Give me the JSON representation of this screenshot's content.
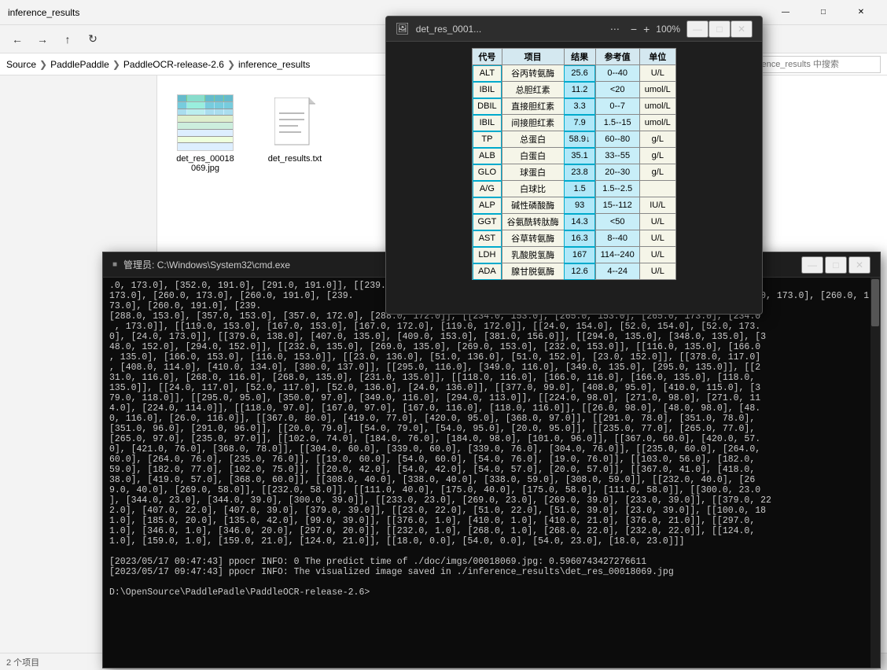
{
  "explorer": {
    "title": "inference_results",
    "breadcrumb": [
      "Source",
      "PaddlePaddle",
      "PaddleOCR-release-2.6",
      "inference_results"
    ],
    "search_placeholder": "在 inference_results 中搜索",
    "files": [
      {
        "name": "det_res_00018069.jpg",
        "type": "jpg"
      },
      {
        "name": "det_results.txt",
        "type": "txt"
      }
    ]
  },
  "viewer": {
    "title": "det_res_0001...",
    "zoom": "100%",
    "table": {
      "headers": [
        "代号",
        "项目",
        "结果",
        "参考值",
        "单位"
      ],
      "rows": [
        [
          "ALT",
          "谷丙转氨酶",
          "25.6",
          "0--40",
          "U/L"
        ],
        [
          "IBIL",
          "总胆红素",
          "11.2",
          "<20",
          "umol/L"
        ],
        [
          "DBIL",
          "直接胆红素",
          "3.3",
          "0--7",
          "umol/L"
        ],
        [
          "IBIL",
          "间接胆红素",
          "7.9",
          "1.5--15",
          "umol/L"
        ],
        [
          "TP",
          "总蛋白",
          "58.9↓",
          "60--80",
          "g/L"
        ],
        [
          "ALB",
          "白蛋白",
          "35.1",
          "33--55",
          "g/L"
        ],
        [
          "GLO",
          "球蛋白",
          "23.8",
          "20--30",
          "g/L"
        ],
        [
          "A/G",
          "白球比",
          "1.5",
          "1.5--2.5",
          ""
        ],
        [
          "ALP",
          "碱性磷酸酶",
          "93",
          "15--112",
          "IU/L"
        ],
        [
          "GGT",
          "谷氨酰转肽酶",
          "14.3",
          "<50",
          "U/L"
        ],
        [
          "AST",
          "谷草转氨酶",
          "16.3",
          "8--40",
          "U/L"
        ],
        [
          "LDH",
          "乳酸脱氢酶",
          "167",
          "114--240",
          "U/L"
        ],
        [
          "ADA",
          "腺甘脱氨酶",
          "12.6",
          "4--24",
          "U/L"
        ]
      ]
    }
  },
  "cmd": {
    "title": "管理员: C:\\Windows\\System32\\cmd.exe",
    "content": ".0, 173.0], [352.0, 191.0], [291.0, 191.0]], [[239.0,\n173.0], [260.0, 173.0], [260.0, 191.0], [239.                                                          , 191.0]], [[239.0, 173.0], [260.0, 173.0], [260.0, 191.0], [239.\n[288.0, 153.0], [357.0, 153.0], [357.0, 172.0], [288.0, 172.0]], [[234.0, 153.0], [265.0, 153.0], [265.0, 173.0], [234.0\n , 173.0]], [[119.0, 153.0], [167.0, 153.0], [167.0, 172.0], [119.0, 172.0]], [[24.0, 154.0], [52.0, 154.0], [52.0, 173.\n0], [24.0, 173.0]], [[379.0, 138.0], [407.0, 135.0], [409.0, 153.0], [381.0, 156.0]], [[294.0, 135.0], [348.0, 135.0], [3\n48.0, 152.0], [294.0, 152.0]], [[232.0, 135.0], [269.0, 135.0], [269.0, 153.0], [232.0, 153.0]], [[116.0, 135.0], [166.0\n, 135.0], [166.0, 153.0], [116.0, 153.0]], [[23.0, 136.0], [51.0, 136.0], [51.0, 152.0], [23.0, 152.0]], [[378.0, 117.0]\n, [408.0, 114.0], [410.0, 134.0], [380.0, 137.0]], [[295.0, 116.0], [349.0, 116.0], [349.0, 135.0], [295.0, 135.0]], [[2\n31.0, 116.0], [268.0, 116.0], [268.0, 135.0], [231.0, 135.0]], [[118.0, 116.0], [166.0, 116.0], [166.0, 135.0], [118.0,\n135.0]], [[24.0, 117.0], [52.0, 117.0], [52.0, 136.0], [24.0, 136.0]], [[377.0, 99.0], [408.0, 95.0], [410.0, 115.0], [3\n79.0, 118.0]], [[295.0, 95.0], [350.0, 97.0], [349.0, 116.0], [294.0, 113.0]], [[224.0, 98.0], [271.0, 98.0], [271.0, 11\n4.0], [224.0, 114.0]], [[118.0, 97.0], [167.0, 97.0], [167.0, 116.0], [118.0, 116.0]], [[26.0, 98.0], [48.0, 98.0], [48.\n0, 116.0], [26.0, 116.0]], [[367.0, 80.0], [419.0, 77.0], [420.0, 95.0], [368.0, 97.0]], [[291.0, 78.0], [351.0, 78.0],\n[351.0, 96.0], [291.0, 96.0]], [[20.0, 79.0], [54.0, 79.0], [54.0, 95.0], [20.0, 95.0]], [[235.0, 77.0], [265.0, 77.0],\n[265.0, 97.0], [235.0, 97.0]], [[102.0, 74.0], [184.0, 76.0], [184.0, 98.0], [101.0, 96.0]], [[367.0, 60.0], [420.0, 57.\n0], [421.0, 76.0], [368.0, 78.0]], [[304.0, 60.0], [339.0, 60.0], [339.0, 76.0], [304.0, 76.0]], [[235.0, 60.0], [264.0,\n60.0], [264.0, 76.0], [235.0, 76.0]], [[19.0, 60.0], [54.0, 60.0], [54.0, 76.0], [19.0, 76.0]], [[103.0, 56.0], [182.0,\n59.0], [182.0, 77.0], [102.0, 75.0]], [[20.0, 42.0], [54.0, 42.0], [54.0, 57.0], [20.0, 57.0]], [[367.0, 41.0], [418.0,\n38.0], [419.0, 57.0], [368.0, 60.0]], [[308.0, 40.0], [338.0, 40.0], [338.0, 59.0], [308.0, 59.0]], [[232.0, 40.0], [26\n9.0, 40.0], [269.0, 58.0]], [[232.0, 58.0]], [[111.0, 40.0], [175.0, 40.0], [175.0, 58.0], [111.0, 58.0]], [[300.0, 23.0\n], [344.0, 23.0], [344.0, 39.0], [300.0, 39.0]], [[233.0, 23.0], [269.0, 23.0], [269.0, 39.0], [233.0, 39.0]], [[379.0, 22\n2.0], [407.0, 22.0], [407.0, 39.0], [379.0, 39.0]], [[23.0, 22.0], [51.0, 22.0], [51.0, 39.0], [23.0, 39.0]], [[100.0, 18\n1.0], [185.0, 20.0], [135.0, 42.0], [99.0, 39.0]], [[376.0, 1.0], [410.0, 1.0], [410.0, 21.0], [376.0, 21.0]], [[297.0,\n1.0], [346.0, 1.0], [346.0, 20.0], [297.0, 20.0]], [[232.0, 1.0], [268.0, 1.0], [268.0, 22.0], [232.0, 22.0]], [[124.0,\n1.0], [159.0, 1.0], [159.0, 21.0], [124.0, 21.0]], [[18.0, 0.0], [54.0, 0.0], [54.0, 23.0], [18.0, 23.0]]]\n\n[2023/05/17 09:47:43] ppocr INFO: 0 The predict time of ./doc/imgs/00018069.jpg: 0.5960743427276611\n[2023/05/17 09:47:43] ppocr INFO: The visualized image saved in ./inference_results\\det_res_00018069.jpg\n\nD:\\OpenSource\\PaddlePadle\\PaddleOCR-release-2.6>",
    "prompt": "D:\\OpenSource\\PaddlePadle\\PaddleOCR-release-2.6>"
  }
}
